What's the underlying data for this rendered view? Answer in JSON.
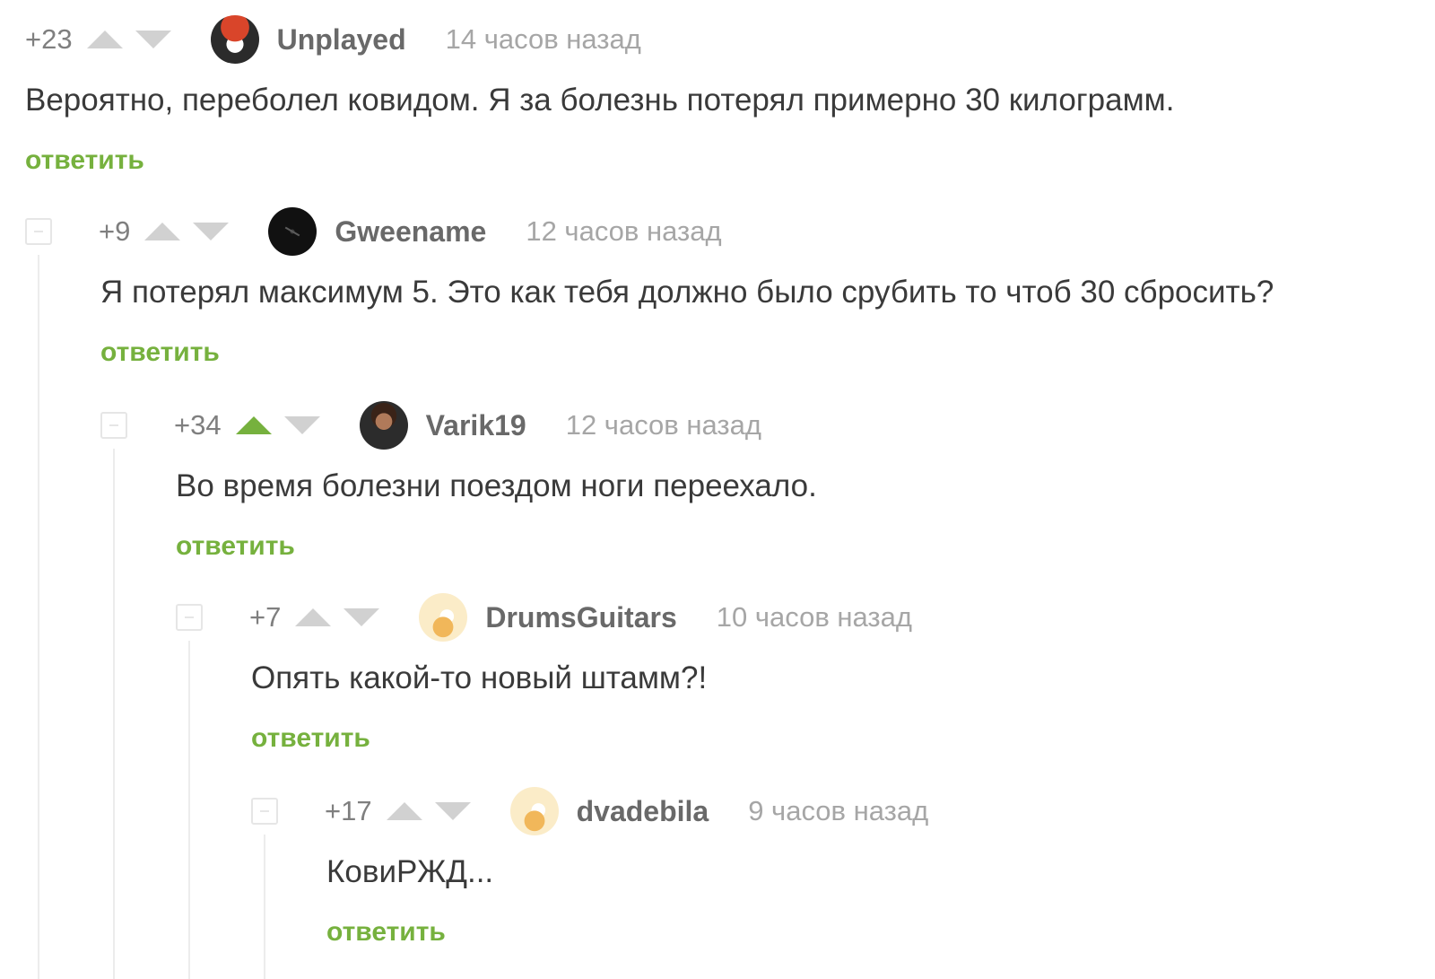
{
  "comments": [
    {
      "rating": "+23",
      "author": "Unplayed",
      "time": "14 часов назад",
      "text": "Вероятно, переболел ковидом. Я за болезнь потерял примерно 30 килограмм.",
      "reply_label": "ответить",
      "vote_up_active": false
    },
    {
      "rating": "+9",
      "author": "Gweename",
      "time": "12 часов назад",
      "text": "Я потерял максимум 5. Это как тебя должно было срубить то чтоб 30 сбросить?",
      "reply_label": "ответить",
      "vote_up_active": false
    },
    {
      "rating": "+34",
      "author": "Varik19",
      "time": "12 часов назад",
      "text": "Во время болезни поездом ноги переехало.",
      "reply_label": "ответить",
      "vote_up_active": true
    },
    {
      "rating": "+7",
      "author": "DrumsGuitars",
      "time": "10 часов назад",
      "text": "Опять какой-то новый штамм?!",
      "reply_label": "ответить",
      "vote_up_active": false
    },
    {
      "rating": "+17",
      "author": "dvadebila",
      "time": "9 часов назад",
      "text": "КовиРЖД...",
      "reply_label": "ответить",
      "vote_up_active": false
    }
  ],
  "colors": {
    "accent_green": "#76b13e",
    "vote_inactive": "#d1d1d1",
    "text": "#3a3a3a",
    "author": "#696969",
    "time": "#a6a6a6"
  }
}
